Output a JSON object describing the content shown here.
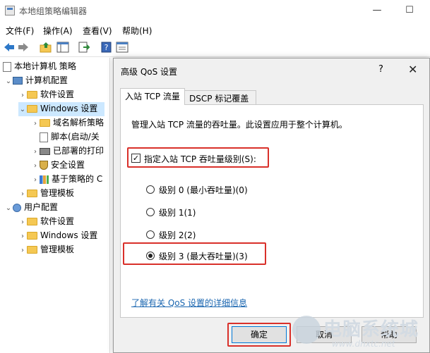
{
  "window": {
    "title": "本地组策略编辑器",
    "minimize": "—",
    "maximize": "☐"
  },
  "menu": [
    {
      "label": "文件(F)"
    },
    {
      "label": "操作(A)"
    },
    {
      "label": "查看(V)"
    },
    {
      "label": "帮助(H)"
    }
  ],
  "toolbar": {
    "icons": [
      "back-icon",
      "forward-icon",
      "up-folder-icon",
      "show-hide-tree-icon",
      "export-list-icon",
      "help-icon",
      "properties-icon"
    ]
  },
  "tree": {
    "root": "本地计算机 策略",
    "computer_config": "计算机配置",
    "software_settings": "软件设置",
    "windows_settings": "Windows 设置",
    "dns": "域名解析策略",
    "scripts": "脚本(启动/关",
    "printers": "已部署的打印",
    "security": "安全设置",
    "policy_qos": "基于策略的 C",
    "admin_templates": "管理模板",
    "user_config": "用户配置",
    "u_software": "软件设置",
    "u_windows": "Windows 设置",
    "u_admin": "管理模板"
  },
  "dialog": {
    "title": "高级 QoS 设置",
    "help": "?",
    "close": "✕",
    "tabs": [
      {
        "label": "入站 TCP 流量",
        "active": true
      },
      {
        "label": "DSCP 标记覆盖",
        "active": false
      }
    ],
    "description": "管理入站 TCP 流量的吞吐量。此设置应用于整个计算机。",
    "checkbox": {
      "label": "指定入站 TCP 吞吐量级别(S):",
      "checked": true
    },
    "radios": [
      {
        "label": "级别 0 (最小吞吐量)(0)",
        "checked": false
      },
      {
        "label": "级别 1(1)",
        "checked": false
      },
      {
        "label": "级别 2(2)",
        "checked": false
      },
      {
        "label": "级别 3 (最大吞吐量)(3)",
        "checked": true
      }
    ],
    "link": "了解有关 QoS 设置的详细信息",
    "buttons": {
      "ok": "确定",
      "cancel": "取消",
      "help": "帮助"
    }
  },
  "watermark": {
    "text": "电脑系统城",
    "url": "www.dnxtc.net"
  },
  "colors": {
    "highlight": "#d9302a",
    "selection": "#cce8ff",
    "link": "#1a66b0"
  }
}
